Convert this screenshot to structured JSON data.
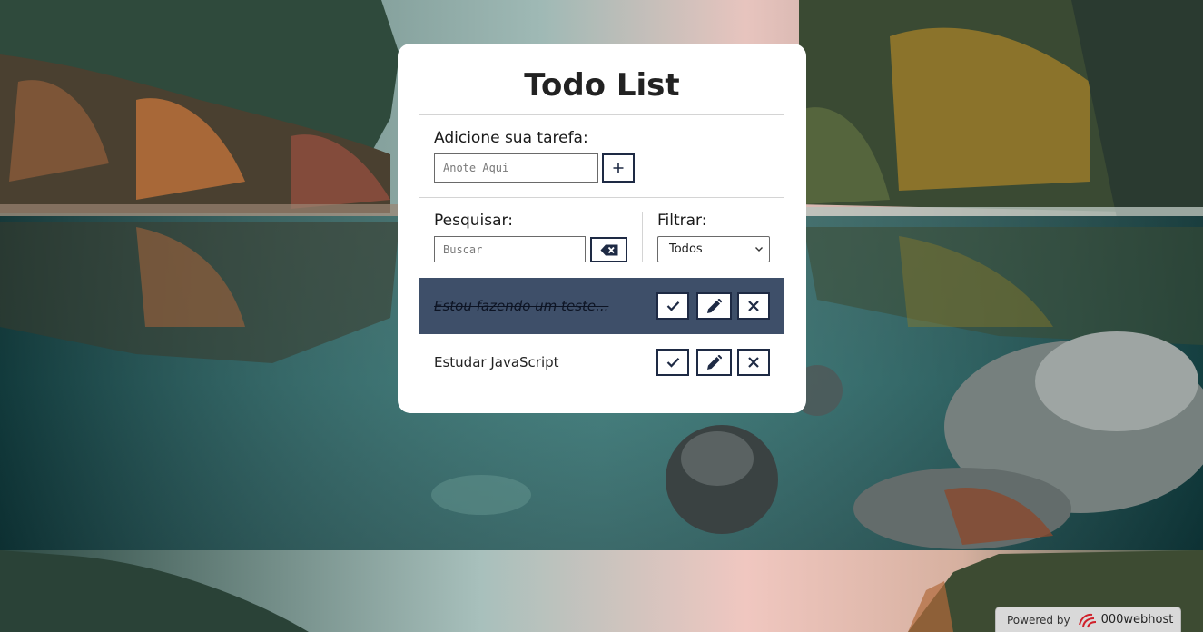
{
  "app": {
    "title": "Todo List"
  },
  "add_section": {
    "label": "Adicione sua tarefa:",
    "input_placeholder": "Anote Aqui",
    "input_value": "",
    "add_button_icon": "plus-icon"
  },
  "search_section": {
    "label": "Pesquisar:",
    "input_placeholder": "Buscar",
    "input_value": "",
    "clear_button_icon": "backspace-icon"
  },
  "filter_section": {
    "label": "Filtrar:",
    "selected": "Todos"
  },
  "todos": [
    {
      "text": "Estou fazendo um teste...",
      "done": true
    },
    {
      "text": "Estudar JavaScript",
      "done": false
    }
  ],
  "todo_action_icons": [
    "check-icon",
    "pencil-icon",
    "close-icon"
  ],
  "footer": {
    "powered_label": "Powered by",
    "brand": "000webhost"
  },
  "colors": {
    "accent": "#1e2a44",
    "done_row": "#3e4f69",
    "card": "#ffffff",
    "brand_logo": "#d0202a"
  }
}
